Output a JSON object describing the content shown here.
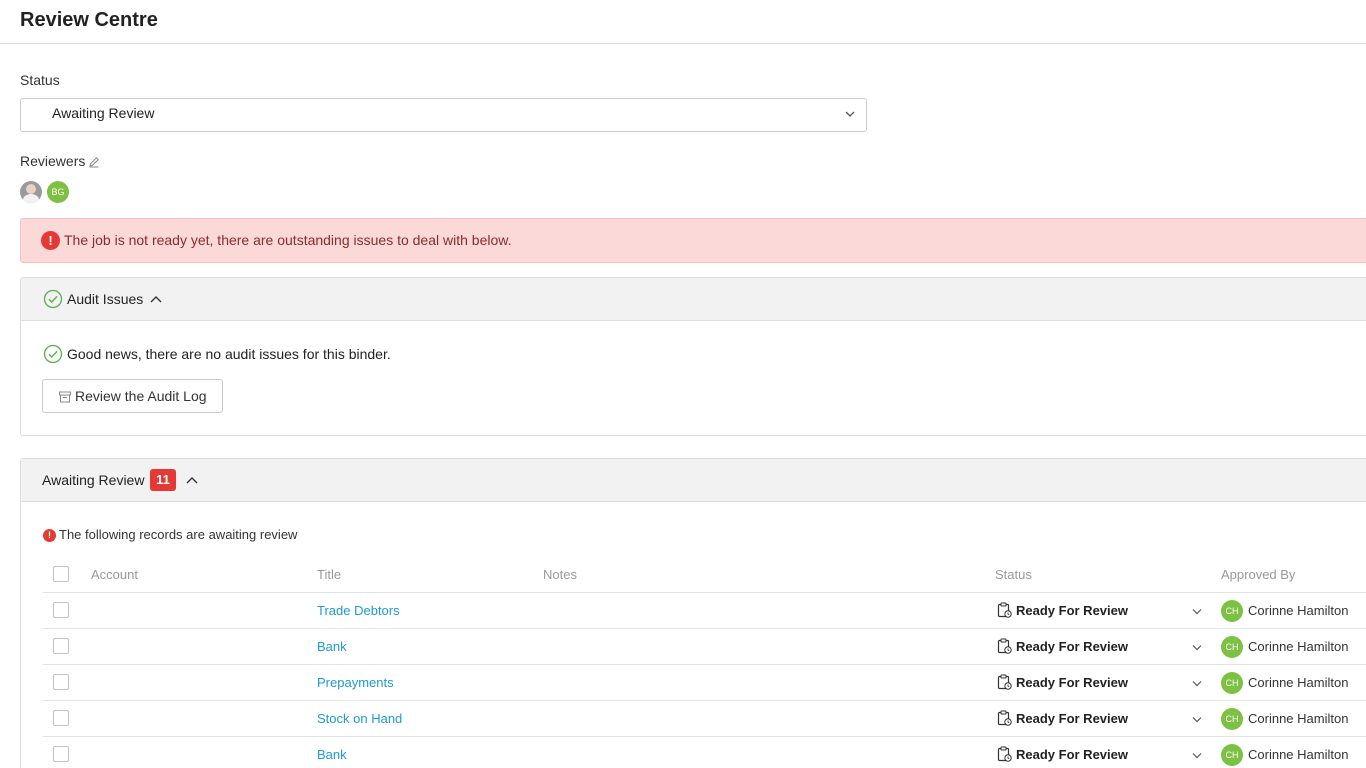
{
  "header": {
    "title": "Review Centre"
  },
  "status_field": {
    "label": "Status",
    "value": "Awaiting Review"
  },
  "reviewers": {
    "label": "Reviewers",
    "avatars": [
      {
        "initials": ""
      },
      {
        "initials": "BG",
        "color": "#7cc142"
      }
    ]
  },
  "alert": {
    "text": "The job is not ready yet, there are outstanding issues to deal with below.",
    "color": "#e53935"
  },
  "audit": {
    "title": "Audit Issues",
    "message": "Good news, there are no audit issues for this binder.",
    "button_label": "Review the Audit Log"
  },
  "awaiting": {
    "title": "Awaiting Review",
    "count": "11",
    "description": "The following records are awaiting review",
    "columns": {
      "account": "Account",
      "title": "Title",
      "notes": "Notes",
      "status": "Status",
      "approved_by": "Approved By"
    },
    "rows": [
      {
        "title": "Trade Debtors",
        "status": "Ready For Review",
        "approver_initials": "CH",
        "approver": "Corinne Hamilton"
      },
      {
        "title": "Bank",
        "status": "Ready For Review",
        "approver_initials": "CH",
        "approver": "Corinne Hamilton"
      },
      {
        "title": "Prepayments",
        "status": "Ready For Review",
        "approver_initials": "CH",
        "approver": "Corinne Hamilton"
      },
      {
        "title": "Stock on Hand",
        "status": "Ready For Review",
        "approver_initials": "CH",
        "approver": "Corinne Hamilton"
      },
      {
        "title": "Bank",
        "status": "Ready For Review",
        "approver_initials": "CH",
        "approver": "Corinne Hamilton"
      }
    ]
  },
  "colors": {
    "accent_green": "#7cc142",
    "link_blue": "#1e9ad6",
    "danger_red": "#e53935"
  }
}
